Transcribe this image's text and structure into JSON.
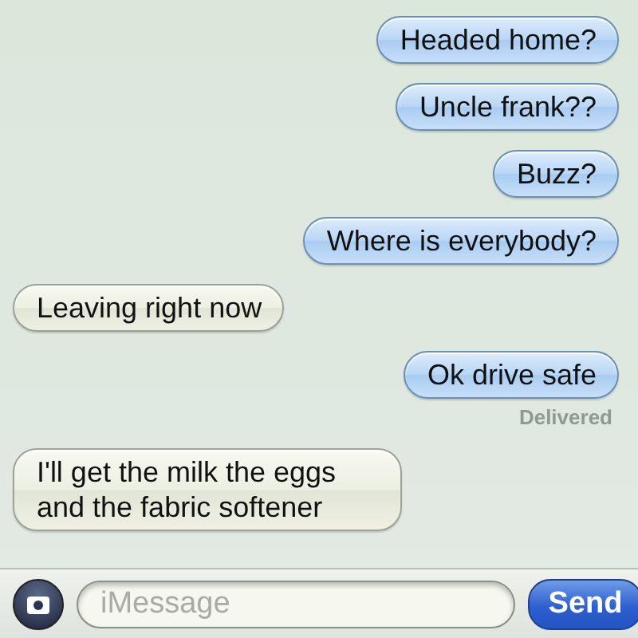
{
  "messages": [
    {
      "kind": "sent",
      "text": "Headed home?"
    },
    {
      "kind": "sent",
      "text": "Uncle frank??"
    },
    {
      "kind": "sent",
      "text": "Buzz?"
    },
    {
      "kind": "sent",
      "text": "Where is everybody?"
    },
    {
      "kind": "received",
      "text": "Leaving right now"
    },
    {
      "kind": "sent",
      "text": "Ok drive safe",
      "status": "Delivered"
    },
    {
      "kind": "received",
      "text": "I'll get the milk the eggs and the fabric softener"
    }
  ],
  "composer": {
    "placeholder": "iMessage",
    "send_label": "Send"
  }
}
